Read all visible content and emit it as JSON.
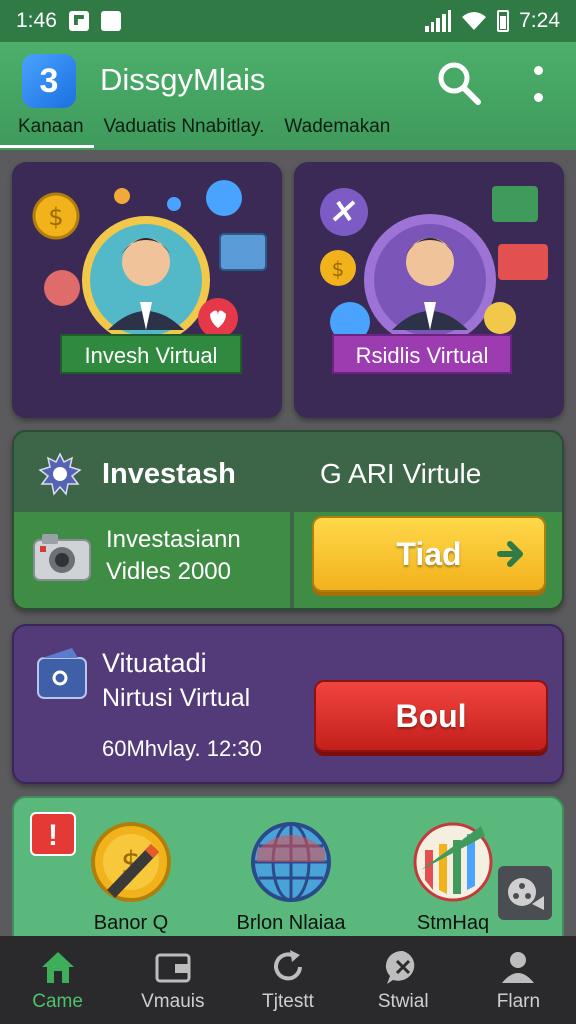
{
  "status_bar": {
    "time_left": "1:46",
    "time_right": "7:24"
  },
  "app": {
    "logo_letter": "3",
    "title": "DissgyMlais"
  },
  "tabs": [
    {
      "label": "Kanaan",
      "active": true
    },
    {
      "label": "Vaduatis Nnabitlay.",
      "active": false
    },
    {
      "label": "Wademakan",
      "active": false
    }
  ],
  "cards": [
    {
      "ribbon": "Invesh Virtual"
    },
    {
      "ribbon": "Rsidlis Virtual"
    }
  ],
  "invest": {
    "title": "Investash",
    "right_label": "G ARI Virtule",
    "line1": "Investasiann",
    "line2": "Vidles 2000",
    "button": "Tiad"
  },
  "virtual": {
    "title": "Vituatadi",
    "subtitle": "Nirtusi Virtual",
    "time": "60Mhvlay. 12:30",
    "button": "Boul"
  },
  "panel": {
    "badge": "!",
    "items": [
      {
        "label": "Banor Q"
      },
      {
        "label": "Brlon Nlaiaa"
      },
      {
        "label": "StmHaq"
      }
    ]
  },
  "bottom_nav": [
    {
      "label": "Came",
      "icon": "home-icon",
      "active": true
    },
    {
      "label": "Vmauis",
      "icon": "wallet-icon",
      "active": false
    },
    {
      "label": "Tjtestt",
      "icon": "refresh-icon",
      "active": false
    },
    {
      "label": "Stwial",
      "icon": "chat-icon",
      "active": false
    },
    {
      "label": "Flarn",
      "icon": "profile-icon",
      "active": false
    }
  ],
  "colors": {
    "status_bar": "#2f7a45",
    "appbar": "#4caf6a",
    "accent_active": "#4fc06a",
    "trade_button": "#f2b21c",
    "buy_button": "#d52a25"
  }
}
